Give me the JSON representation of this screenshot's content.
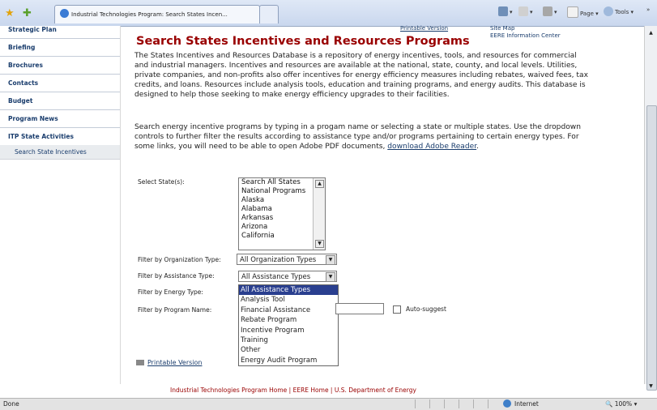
{
  "browser": {
    "tab_title": "Industrial Technologies Program: Search States Incen...",
    "tools": {
      "page": "Page ▾",
      "tools": "Tools ▾",
      "more": "»"
    }
  },
  "sidebar": {
    "items": [
      {
        "label": "Strategic Plan"
      },
      {
        "label": "Briefing"
      },
      {
        "label": "Brochures"
      },
      {
        "label": "Contacts"
      },
      {
        "label": "Budget"
      },
      {
        "label": "Program News"
      },
      {
        "label": "ITP State Activities"
      }
    ],
    "subitem": "Search State Incentives"
  },
  "header": {
    "printable_link": "Printable Version",
    "site_map": "Site Map",
    "info_center": "EERE Information Center",
    "title": "Search States Incentives and Resources Programs"
  },
  "content": {
    "intro": "The States Incentives and Resources Database is a repository of energy incentives, tools, and resources for commercial and industrial managers. Incentives and resources are available at the national, state, county, and local levels. Utilities, private companies, and non-profits also offer incentives for energy efficiency measures including rebates, waived fees, tax credits, and loans. Resources include analysis tools, education and training programs, and energy audits. This database is designed to help those seeking to make energy efficiency upgrades to their facilities.",
    "instructions": "Search energy incentive programs by typing in a progam name or selecting a state or multiple states. Use the dropdown controls to further filter the results according to assistance type and/or programs pertaining to certain energy types. For some links, you will need to be able to open Adobe PDF documents, ",
    "adobe_link": "download Adobe Reader",
    "adobe_end": "."
  },
  "form": {
    "state_label": "Select State(s):",
    "states": [
      "Search All States",
      "National Programs",
      "Alaska",
      "Alabama",
      "Arkansas",
      "Arizona",
      "California"
    ],
    "org_label": "Filter by Organization Type:",
    "org_value": "All Organization Types",
    "assist_label": "Filter by Assistance Type:",
    "assist_value": "All Assistance Types",
    "assist_options": [
      "All Assistance Types",
      "Analysis Tool",
      "Financial Assistance",
      "Rebate Program",
      "Incentive Program",
      "Training",
      "Other",
      "Energy Audit Program"
    ],
    "energy_label": "Filter by Energy Type:",
    "name_label": "Filter by Program Name:",
    "autosuggest_label": "Auto-suggest"
  },
  "footer": {
    "printable": "Printable Version",
    "links": "Industrial Technologies Program Home | EERE Home | U.S. Department of Energy"
  },
  "status": {
    "text": "Done",
    "zone": "Internet",
    "zoom": "100%"
  }
}
